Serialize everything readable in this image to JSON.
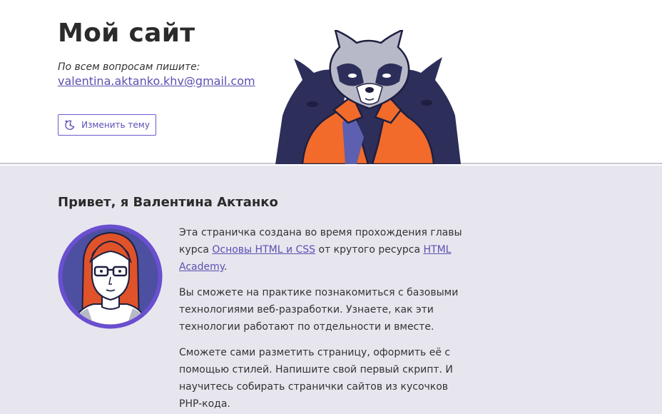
{
  "header": {
    "site_title": "Мой сайт",
    "contact_caption": "По всем вопросам пишите:",
    "contact_email": "valentina.aktanko.khv@gmail.com",
    "theme_button_label": "Изменить тему",
    "theme_button_icon": "moon-sun-icon",
    "mascot_icon": "raccoon-mascot-illustration"
  },
  "about": {
    "title": "Привет, я Валентина Актанко",
    "avatar_icon": "woman-avatar-illustration",
    "p1_before": "Эта страничка создана во время прохождения главы курса ",
    "p1_link1": "Основы HTML и CSS",
    "p1_middle": " от крутого ресурса ",
    "p1_link2": "HTML Academy",
    "p1_after": ".",
    "p2": "Вы сможете на практике познакомиться с базовыми технологиями веб-разработки. Узнаете, как эти технологии работают по отдельности и вместе.",
    "p3": "Сможете сами разметить страницу, оформить её с помощью стилей. Напишите свой первый скрипт. И научитесь собирать странички сайтов из кусочков PHP-кода."
  },
  "colors": {
    "accent": "#5b4fb0",
    "header_bg": "#ffffff",
    "main_bg": "#e7e6ef",
    "mascot_orange": "#f26b2a",
    "mascot_navy": "#2d2f5a",
    "avatar_ring": "#6a4fd0",
    "avatar_hair": "#e0522a"
  }
}
